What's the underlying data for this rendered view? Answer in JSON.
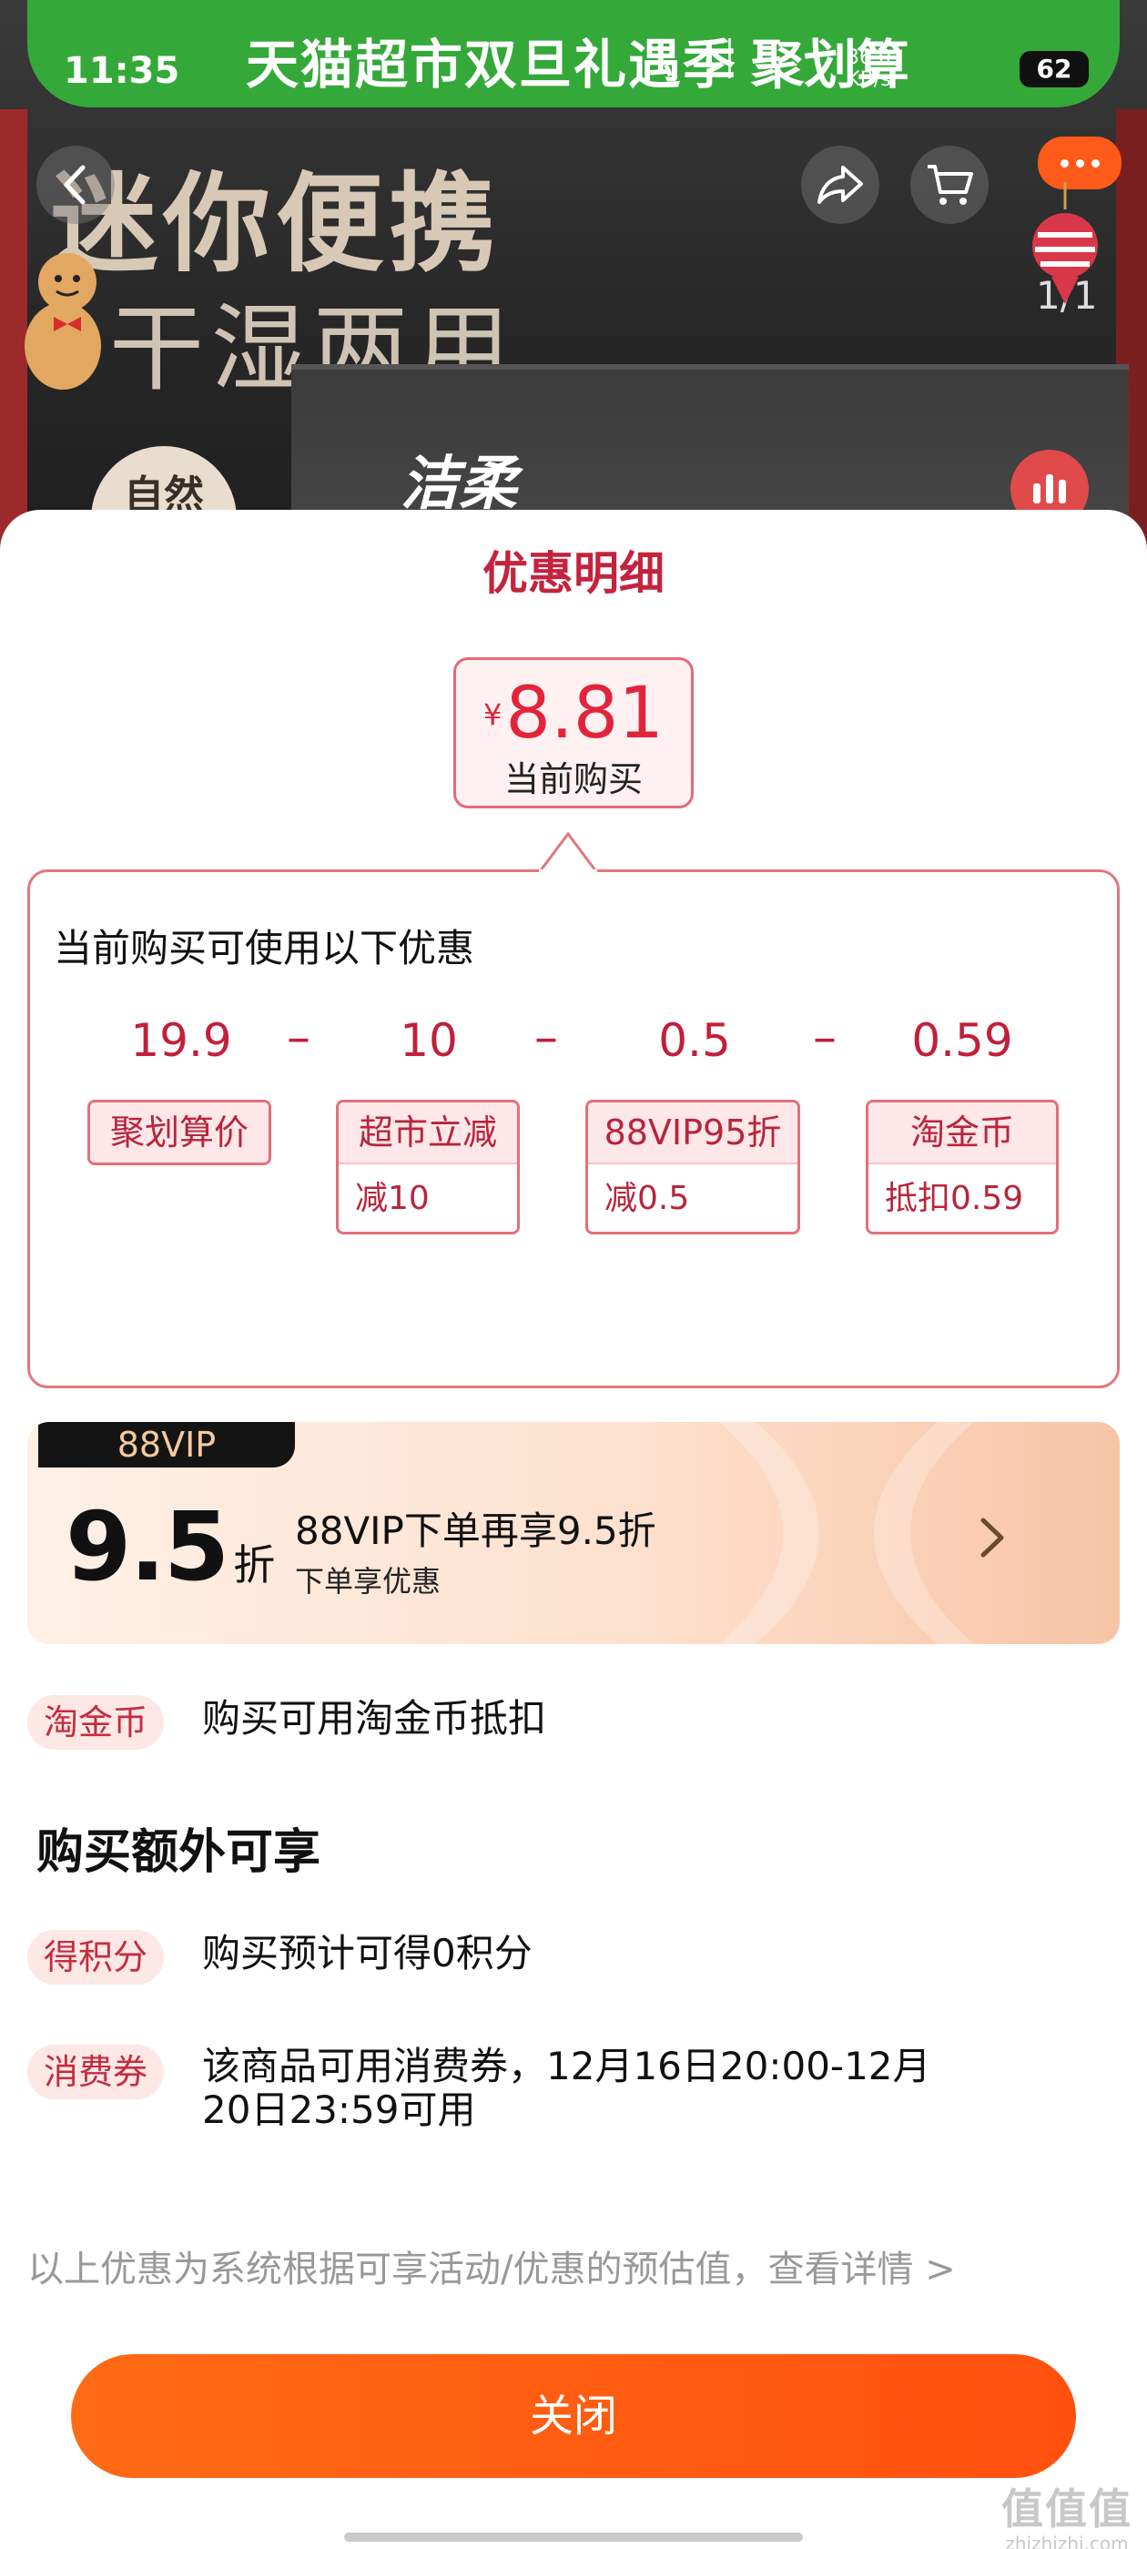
{
  "status_bar": {
    "time": "11:35",
    "network": "36.0",
    "network_unit": "KB/s",
    "battery": "62"
  },
  "promo_banner": {
    "text": "天猫超市双旦礼遇季",
    "text2": "聚划算"
  },
  "product_page": {
    "hero_title_line1": "迷你便携",
    "hero_title_line2": "干湿两用",
    "brand_logo": "洁柔",
    "tag_circle": "自然",
    "image_counter": "1/1"
  },
  "sheet": {
    "title": "优惠明细",
    "price": {
      "currency": "¥",
      "value": "8.81",
      "label": "当前购买"
    },
    "detail": {
      "heading": "当前购买可使用以下优惠",
      "operator": "–",
      "items": [
        {
          "value": "19.9",
          "tag": "聚划算价",
          "sub": ""
        },
        {
          "value": "10",
          "tag": "超市立减",
          "sub": "减10"
        },
        {
          "value": "0.5",
          "tag": "88VIP95折",
          "sub": "减0.5"
        },
        {
          "value": "0.59",
          "tag": "淘金币",
          "sub": "抵扣0.59"
        }
      ]
    },
    "vip": {
      "badge": "88VIP",
      "discount": "9.5",
      "discount_unit": "折",
      "title": "88VIP下单再享9.5折",
      "subtitle": "下单享优惠"
    },
    "coin_row": {
      "tag": "淘金币",
      "text": "购买可用淘金币抵扣"
    },
    "extra_heading": "购买额外可享",
    "points_row": {
      "tag": "得积分",
      "text": "购买预计可得0积分"
    },
    "voucher_row": {
      "tag": "消费券",
      "text_line1": "该商品可用消费券，12月16日20:00-12月",
      "text_line2": "20日23:59可用"
    },
    "disclaimer": "以上优惠为系统根据可享活动/优惠的预估值，查看详情 >",
    "close_label": "关闭"
  },
  "watermark": {
    "logo": "值值值",
    "url": "zhizhizhi.com"
  },
  "colors": {
    "accent_red": "#c4233e",
    "close_orange": "#ff6a14",
    "promo_green": "#35a83a",
    "vip_black": "#141414"
  }
}
